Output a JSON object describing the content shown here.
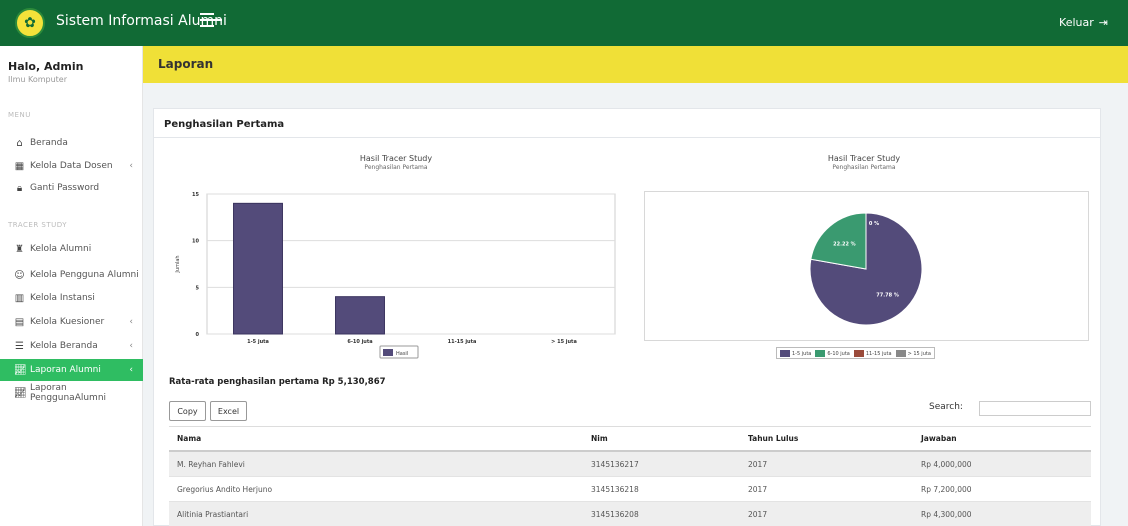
{
  "topnav": {
    "title": "Sistem Informasi Alumni",
    "logout_label": "Keluar"
  },
  "sidebar": {
    "user_name": "Halo, Admin",
    "user_role": "Ilmu Komputer",
    "section_menu": "MENU",
    "section_tracer": "TRACER STUDY",
    "items": [
      {
        "label": "Beranda",
        "icon": "home-icon"
      },
      {
        "label": "Kelola Data Dosen",
        "icon": "table-icon"
      },
      {
        "label": "Ganti Password",
        "icon": "lock-icon"
      },
      {
        "label": "Kelola Alumni",
        "icon": "graduate-icon"
      },
      {
        "label": "Kelola Pengguna Alumni",
        "icon": "user-icon"
      },
      {
        "label": "Kelola Instansi",
        "icon": "building-icon"
      },
      {
        "label": "Kelola Kuesioner",
        "icon": "clipboard-icon"
      },
      {
        "label": "Kelola Beranda",
        "icon": "menu-icon"
      },
      {
        "label": "Laporan Alumni",
        "icon": "chart-icon"
      },
      {
        "label": "Laporan PenggunaAlumni",
        "icon": "chart-icon"
      }
    ]
  },
  "header": {
    "title": "Laporan"
  },
  "card": {
    "title": "Penghasilan Pertama",
    "average_text": "Rata-rata penghasilan pertama Rp 5,130,867",
    "copy_label": "Copy",
    "excel_label": "Excel",
    "search_label": "Search:"
  },
  "colors": {
    "series1": "#534b7a",
    "series2": "#3a9a70",
    "series3": "#9a4a3a",
    "series4": "#888888",
    "nav": "#116a35",
    "header": "#f0e037",
    "active": "#2fbd62"
  },
  "chart_data": [
    {
      "type": "bar",
      "title": "Hasil Tracer Study",
      "subtitle": "Penghasilan Pertama",
      "ylabel": "Jumlah",
      "categories": [
        "1-5 juta",
        "6-10 juta",
        "11-15 juta",
        "> 15 juta"
      ],
      "series": [
        {
          "name": "Hasil",
          "values": [
            14,
            4,
            0,
            0
          ]
        }
      ],
      "yticks": [
        "0",
        "5",
        "10",
        "15"
      ],
      "ylim": [
        0,
        15
      ],
      "grid": true,
      "legend": "bottom"
    },
    {
      "type": "pie",
      "title": "Hasil Tracer Study",
      "subtitle": "Penghasilan Pertama",
      "categories": [
        "1-5 juta",
        "6-10 juta",
        "11-15 juta",
        "> 15 juta"
      ],
      "values": [
        77.78,
        22.22,
        0,
        0
      ],
      "labels": [
        "77.78 %",
        "22.22 %",
        "0 %",
        "0 %"
      ],
      "legend": "bottom"
    }
  ],
  "table": {
    "headers": [
      "Nama",
      "Nim",
      "Tahun Lulus",
      "Jawaban"
    ],
    "rows": [
      [
        "M. Reyhan Fahlevi",
        "3145136217",
        "2017",
        "Rp 4,000,000"
      ],
      [
        "Gregorius Andito Herjuno",
        "3145136218",
        "2017",
        "Rp 7,200,000"
      ],
      [
        "Alitinia Prastiantari",
        "3145136208",
        "2017",
        "Rp 4,300,000"
      ]
    ]
  }
}
